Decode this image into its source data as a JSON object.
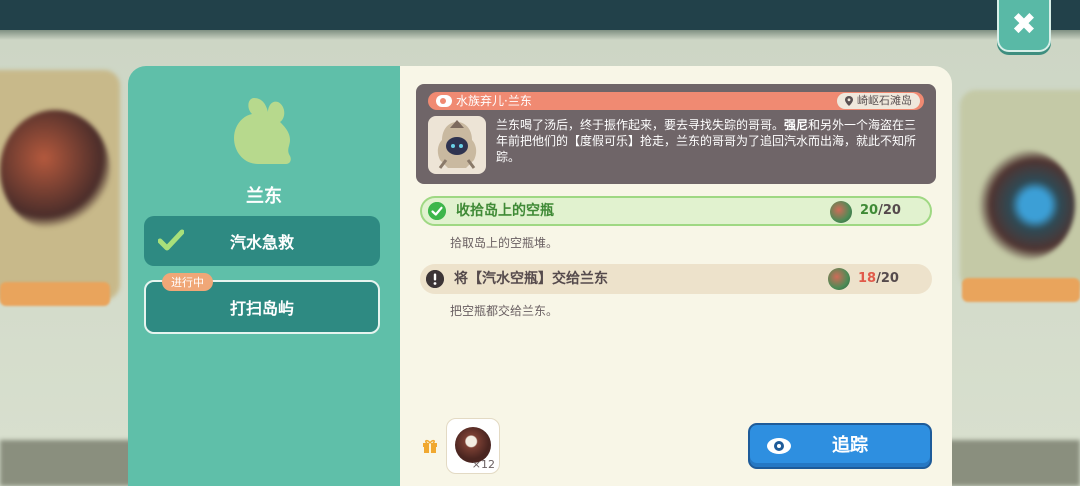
{
  "npc": {
    "name": "兰东"
  },
  "quests": [
    {
      "label": "汽水急救",
      "status": ""
    },
    {
      "label": "打扫岛屿",
      "status": "进行中"
    }
  ],
  "info": {
    "speaker": "水族弃儿·兰东",
    "location": "崎岖石滩岛",
    "text_before": "兰东喝了汤后，终于振作起来，要去寻找失踪的哥哥。",
    "text_bold": "强尼",
    "text_after": "和另外一个海盗在三年前把他们的【度假可乐】抢走，兰东的哥哥为了追回汽水而出海，就此不知所踪。"
  },
  "objectives": [
    {
      "label": "收拾岛上的空瓶",
      "current": "20",
      "total": "20",
      "desc": "拾取岛上的空瓶堆。",
      "complete": true
    },
    {
      "label": "将【汽水空瓶】交给兰东",
      "current": "18",
      "total": "20",
      "desc": "把空瓶都交给兰东。",
      "complete": false
    }
  ],
  "reward": {
    "qty": "×12"
  },
  "track_button": "追踪",
  "colors": {
    "panel_left": "#5fbfa9",
    "panel_right": "#f8f6e7",
    "quest_button": "#2e8a82",
    "track_button": "#2e8fe0",
    "complete_green": "#3f8a36",
    "incomplete_red": "#e15a4a"
  },
  "icons": [
    "close-icon",
    "check-icon",
    "speaker-icon",
    "pin-icon",
    "alert-icon",
    "gift-icon",
    "eye-icon",
    "coconut-icon"
  ]
}
